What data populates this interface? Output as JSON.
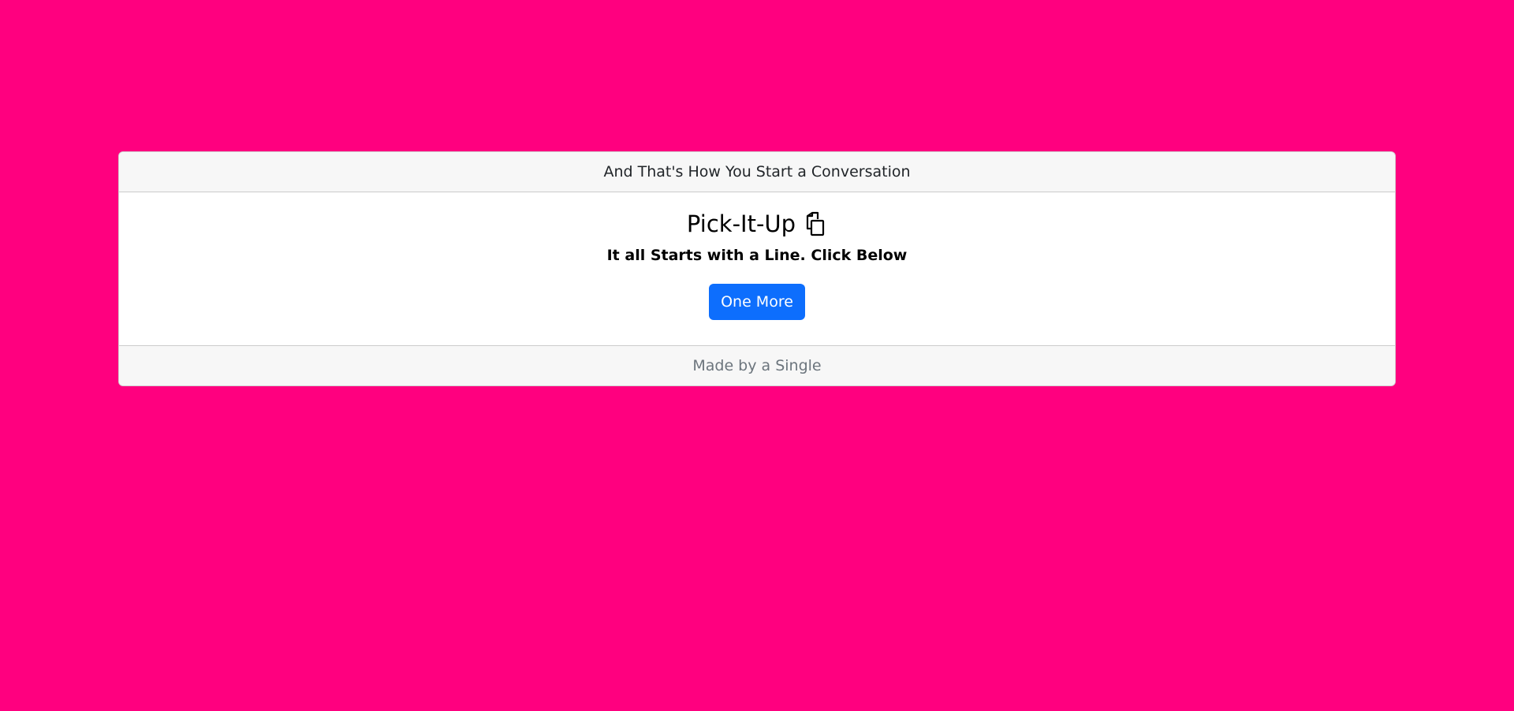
{
  "card": {
    "header_text": "And That's How You Start a Conversation",
    "title": "Pick-It-Up",
    "title_icon": "copy-icon",
    "subtitle": "It all Starts with a Line. Click Below",
    "button_label": "One More",
    "footer_text": "Made by a Single"
  },
  "colors": {
    "background": "#ff007f",
    "button": "#0d6efd",
    "card_chrome": "#f7f7f7"
  }
}
